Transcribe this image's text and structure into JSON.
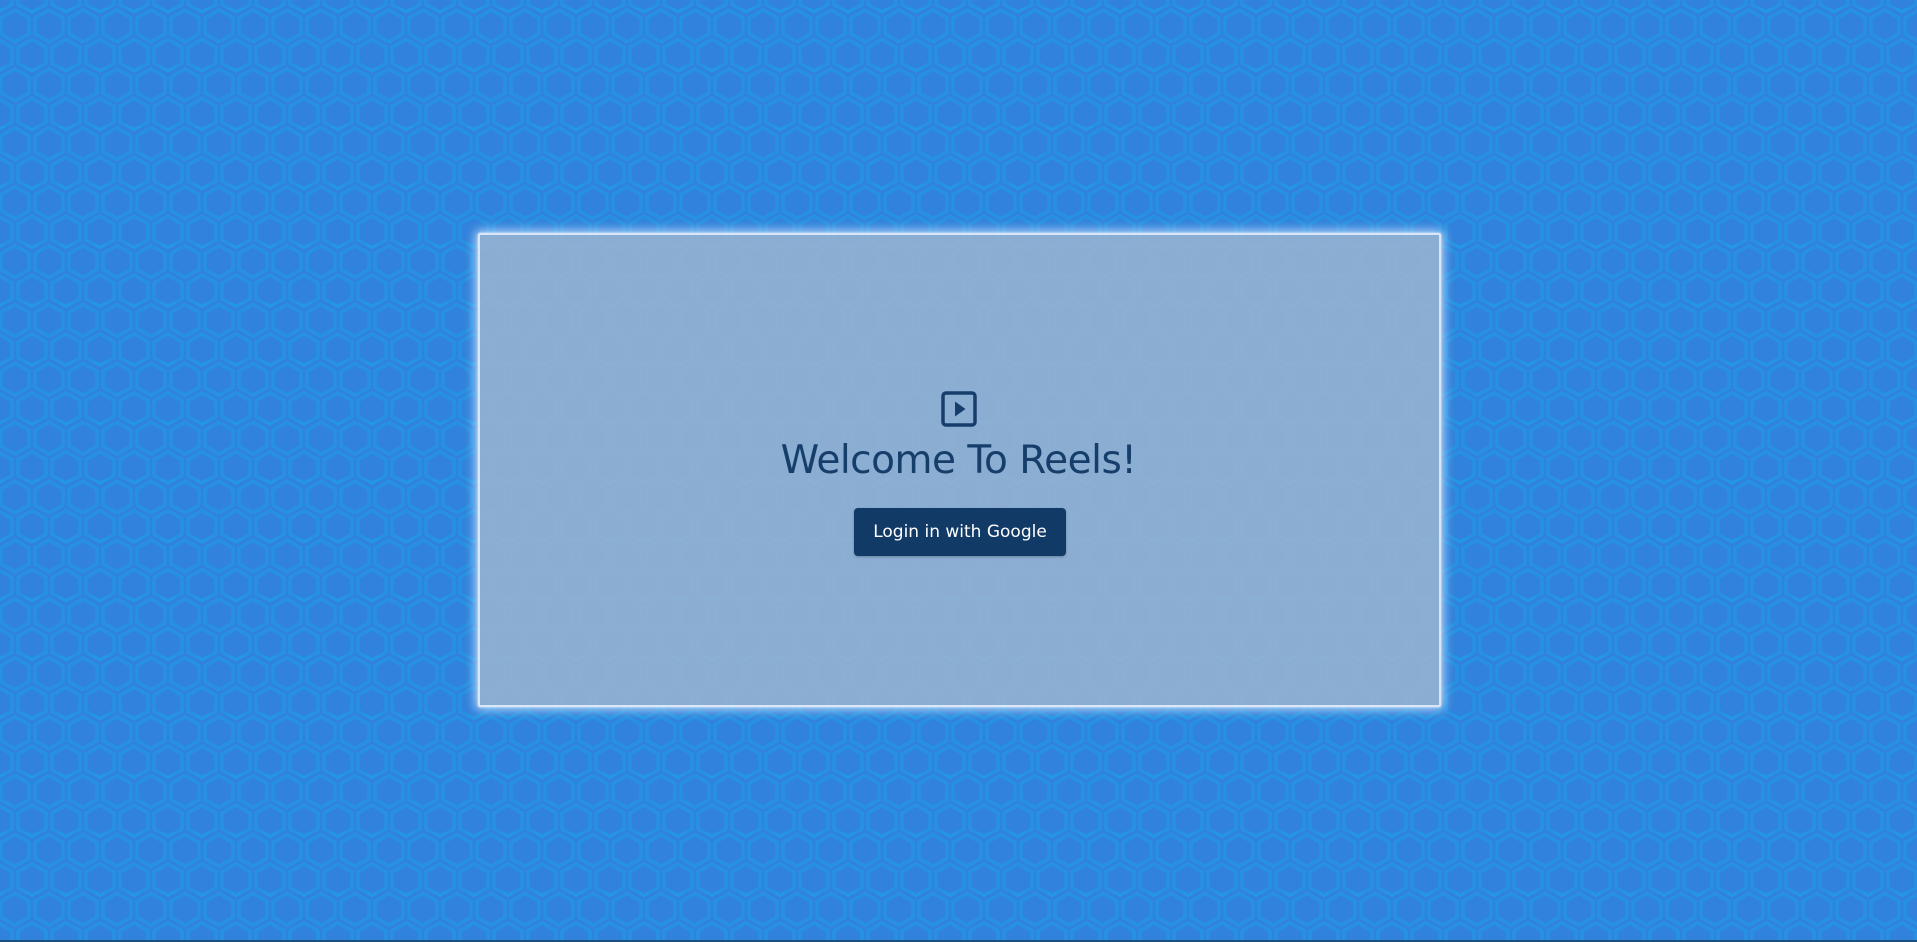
{
  "colors": {
    "background": "#3182dc",
    "hex_line": "#1e9ae6",
    "card": "#8fb0d4",
    "title_text": "#163e6a",
    "button_bg": "#123a67",
    "button_text": "#ffffff"
  },
  "logo": {
    "icon": "play-square-icon"
  },
  "welcome": {
    "title": "Welcome To Reels!"
  },
  "login": {
    "button_label": "Login in with Google"
  }
}
